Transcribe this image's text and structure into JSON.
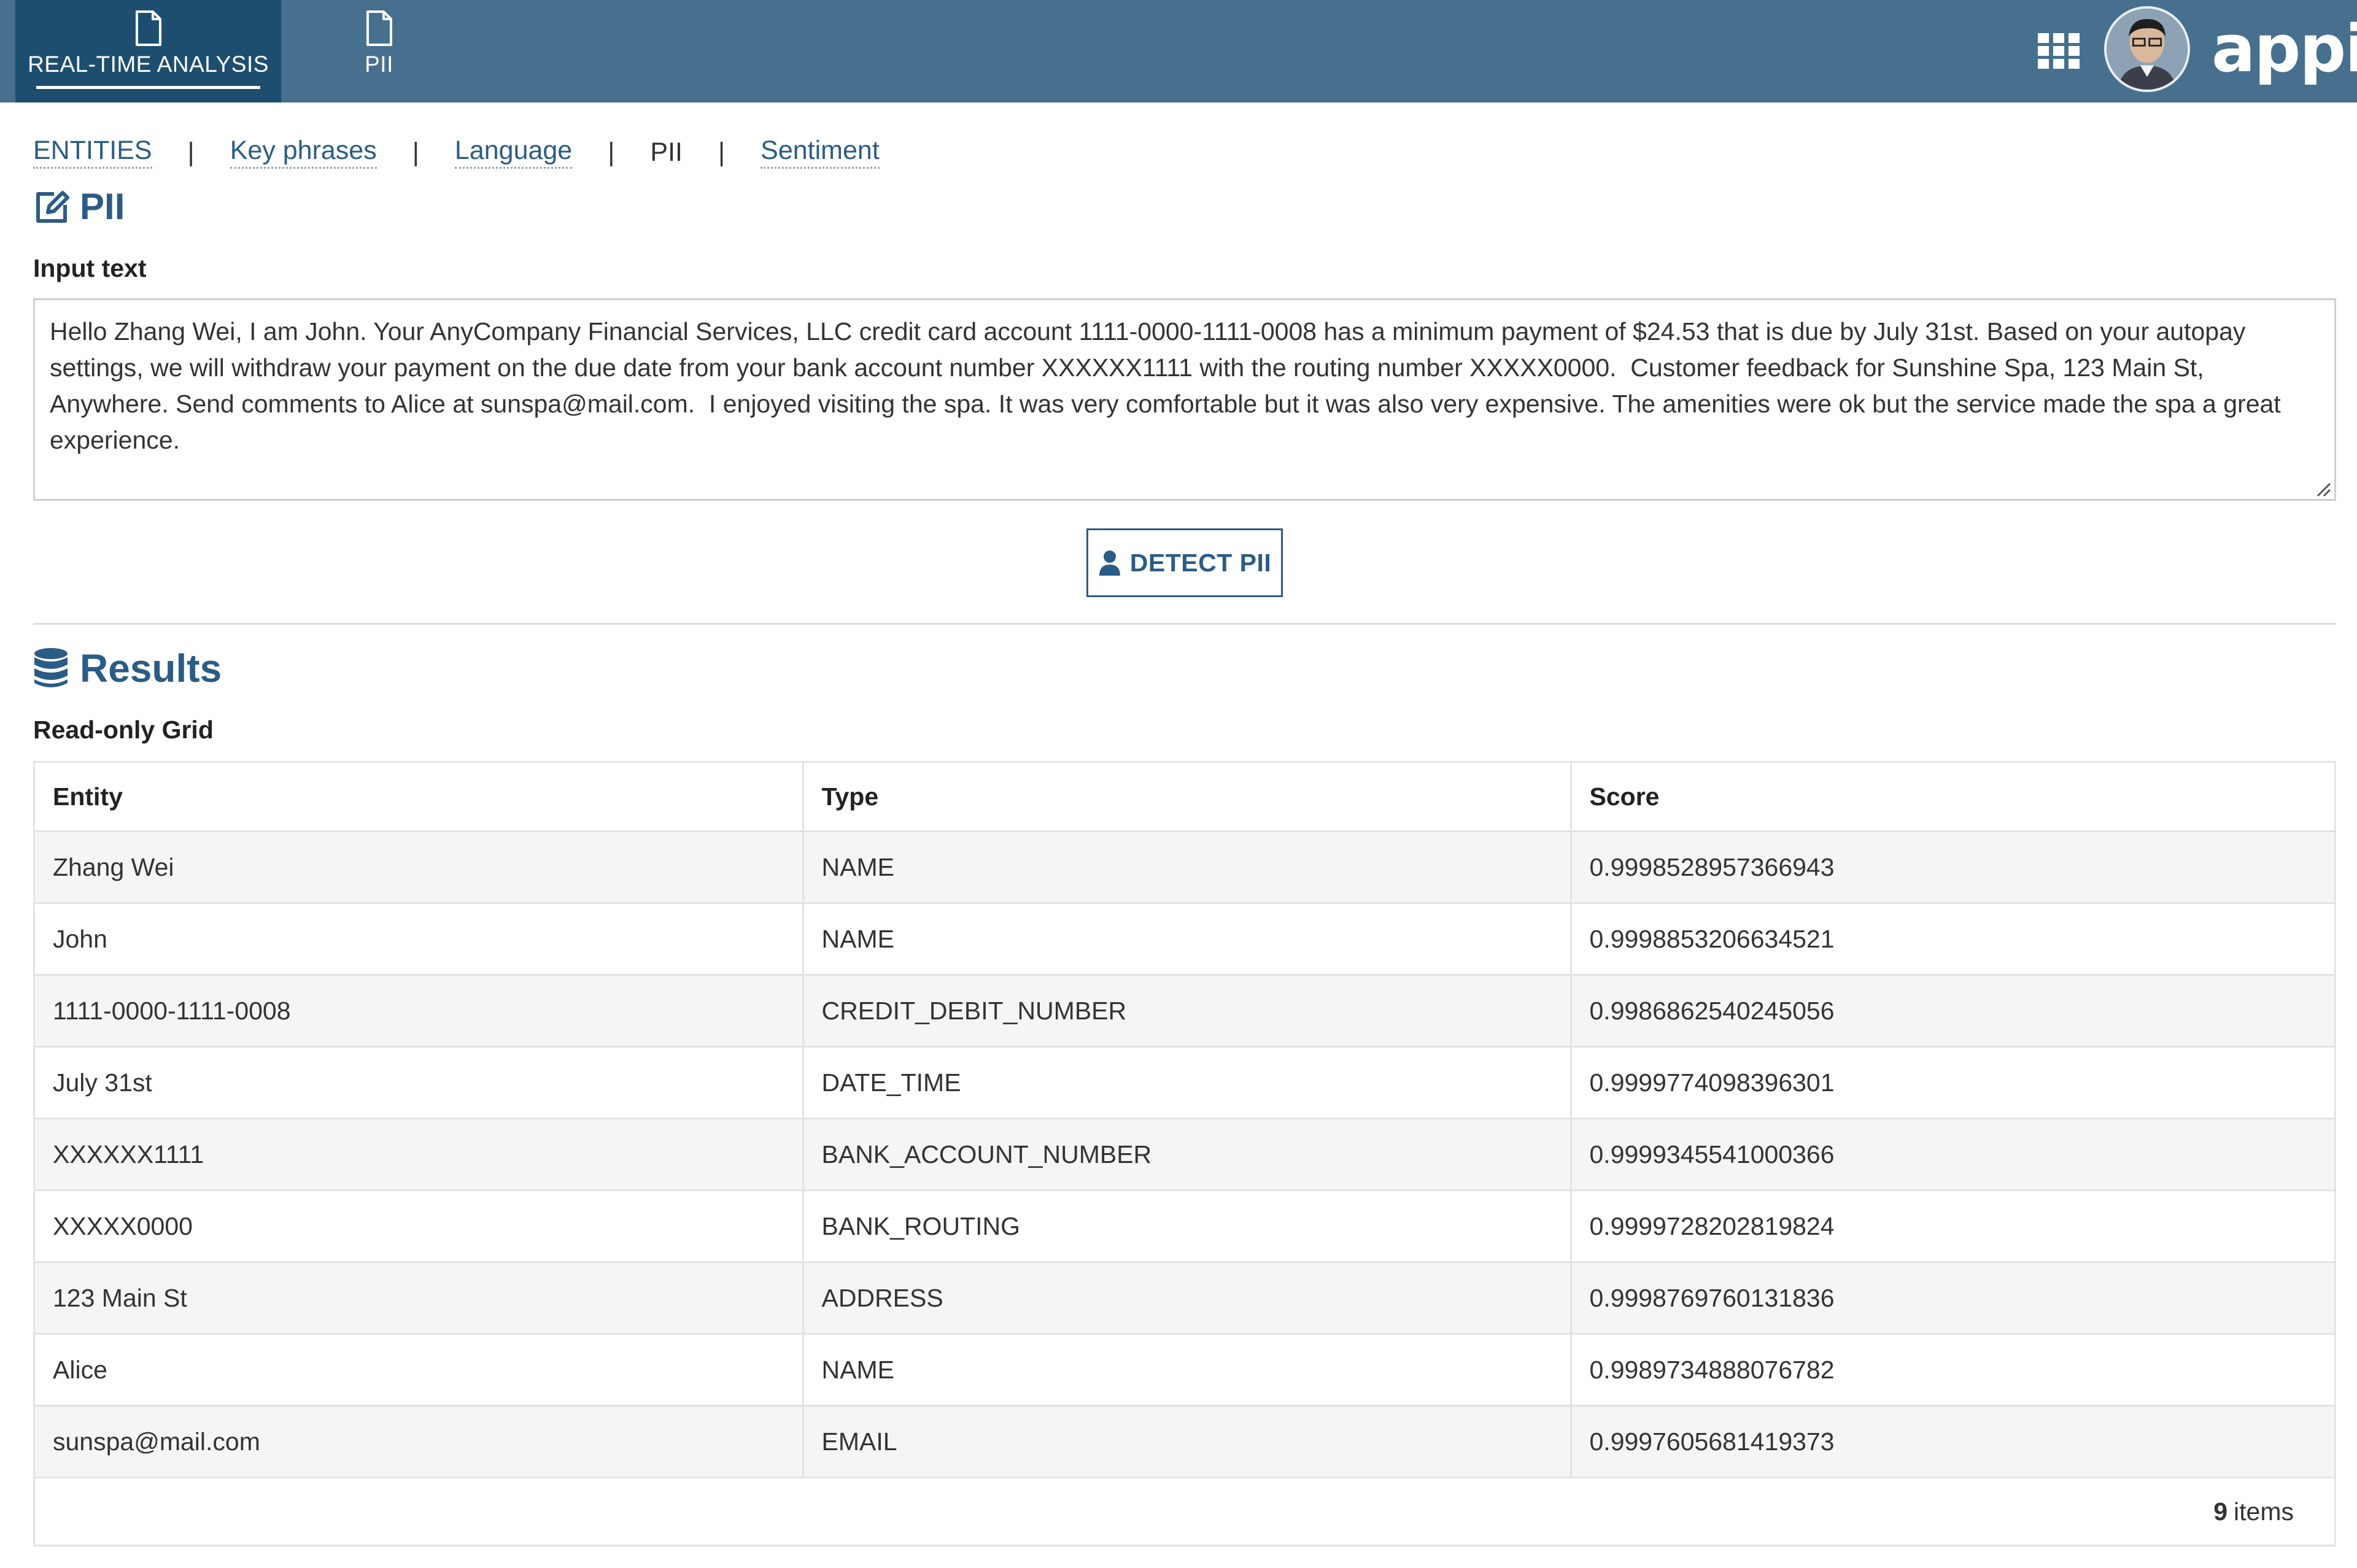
{
  "header": {
    "tabs": [
      {
        "label": "REAL-TIME ANALYSIS",
        "active": true,
        "icon": "document-icon"
      },
      {
        "label": "PII",
        "active": false,
        "icon": "document-icon"
      }
    ],
    "brand": "appian",
    "icons": {
      "apps": "grid-icon",
      "user": "avatar"
    },
    "colors": {
      "bar": "#47708f",
      "active_tab": "#1d4e6f"
    }
  },
  "links": {
    "entities": "ENTITIES",
    "key_phrases": "Key phrases",
    "language": "Language",
    "pii": "PII",
    "sentiment": "Sentiment",
    "separator": "|"
  },
  "pii_section": {
    "title": "PII",
    "icon": "edit-icon",
    "input_label": "Input text",
    "input_value": "Hello Zhang Wei, I am John. Your AnyCompany Financial Services, LLC credit card account 1111-0000-1111-0008 has a minimum payment of $24.53 that is due by July 31st. Based on your autopay settings, we will withdraw your payment on the due date from your bank account number XXXXXX1111 with the routing number XXXXX0000.  Customer feedback for Sunshine Spa, 123 Main St, Anywhere. Send comments to Alice at sunspa@mail.com.  I enjoyed visiting the spa. It was very comfortable but it was also very expensive. The amenities were ok but the service made the spa a great experience.",
    "button_label": "DETECT PII",
    "button_icon": "user-icon"
  },
  "results": {
    "title": "Results",
    "icon": "database-icon",
    "grid_label": "Read-only Grid",
    "columns": [
      "Entity",
      "Type",
      "Score"
    ],
    "rows": [
      [
        "Zhang Wei",
        "NAME",
        "0.9998528957366943"
      ],
      [
        "John",
        "NAME",
        "0.9998853206634521"
      ],
      [
        "1111-0000-1111-0008",
        "CREDIT_DEBIT_NUMBER",
        "0.9986862540245056"
      ],
      [
        "July 31st",
        "DATE_TIME",
        "0.9999774098396301"
      ],
      [
        "XXXXXX1111",
        "BANK_ACCOUNT_NUMBER",
        "0.9999345541000366"
      ],
      [
        "XXXXX0000",
        "BANK_ROUTING",
        "0.9999728202819824"
      ],
      [
        "123 Main St",
        "ADDRESS",
        "0.9998769760131836"
      ],
      [
        "Alice",
        "NAME",
        "0.9989734888076782"
      ],
      [
        "sunspa@mail.com",
        "EMAIL",
        "0.9997605681419373"
      ]
    ],
    "count": "9",
    "count_suffix": "items"
  }
}
